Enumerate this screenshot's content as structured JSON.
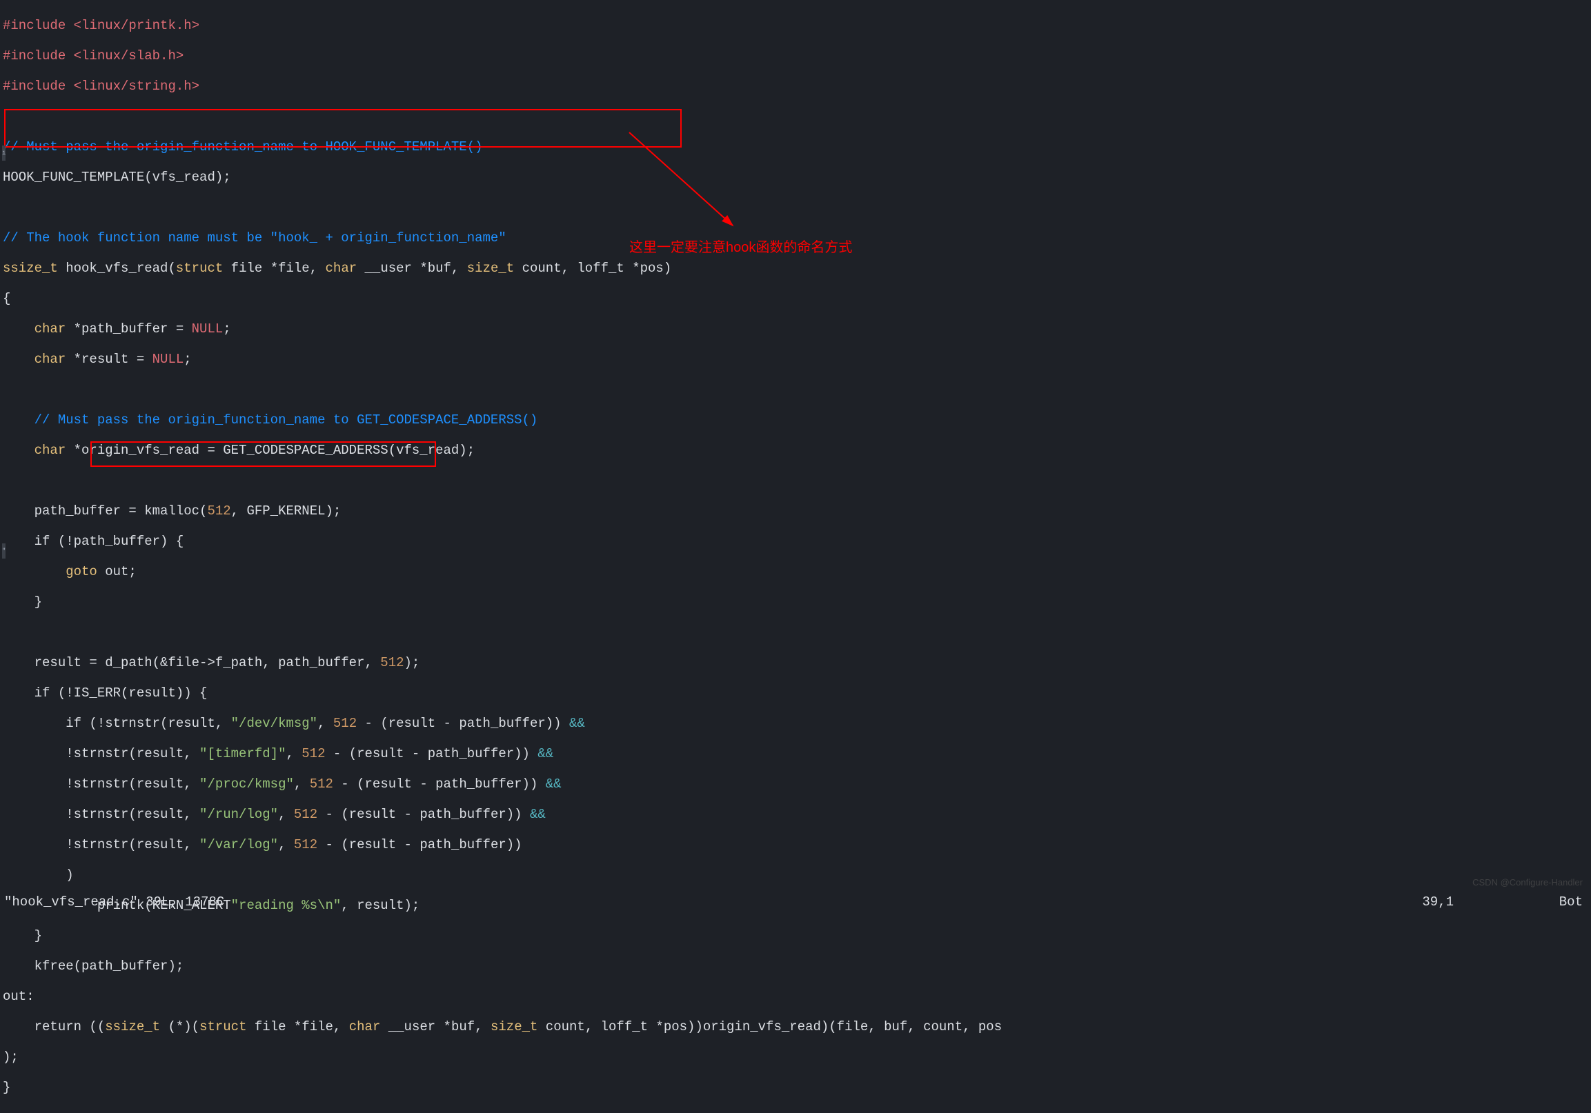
{
  "annotation_text": "这里一定要注意hook函数的命名方式",
  "code": {
    "inc1_kw": "#include",
    "inc1_path": " <linux/printk.h>",
    "inc2_kw": "#include",
    "inc2_path": " <linux/slab.h>",
    "inc3_kw": "#include",
    "inc3_path": " <linux/string.h>",
    "c1": "// Must pass the origin_function_name to HOOK_FUNC_TEMPLATE()",
    "l1": "HOOK_FUNC_TEMPLATE(vfs_read);",
    "c2": "// The hook function name must be \"hook_ + origin_function_name\"",
    "sig_ssize": "ssize_t",
    "sig_name": " hook_vfs_read(",
    "sig_struct": "struct",
    "sig_file_ptr": " file *file, ",
    "sig_char": "char",
    "sig_user_buf": " __user *buf, ",
    "sig_sizet": "size_t",
    "sig_count": " count, loff_t *pos)",
    "char_kw": "char",
    "pb_decl": " *path_buffer = ",
    "null_kw": "NULL",
    "semi": ";",
    "res_decl": " *result = ",
    "c3": "// Must pass the origin_function_name to GET_CODESPACE_ADDERSS()",
    "ovr": " *origin_vfs_read = GET_CODESPACE_ADDERSS(vfs_read);",
    "pb_km": "    path_buffer = kmalloc(",
    "n512": "512",
    "gfp": ", GFP_KERNEL);",
    "if_pb": "    if (!path_buffer) {",
    "goto_kw": "goto",
    "out_lbl": " out;",
    "brace_close": "    }",
    "res_dpath1": "    result = d_path(&file->f_path, path_buffer, ",
    "res_dpath2": ");",
    "if_iserr": "    if (!IS_ERR(result)) {",
    "if_strn1a": "        if (!strnstr(result, ",
    "s_devkmsg": "\"/dev/kmsg\"",
    "strn_mid": ", ",
    "strn_tail": " - (result - path_buffer)) ",
    "and": "&&",
    "bang_strn": "        !strnstr(result, ",
    "s_timerfd": "\"[timerfd]\"",
    "s_prockmsg": "\"/proc/kmsg\"",
    "s_runlog": "\"/run/log\"",
    "s_varlog": "\"/var/log\"",
    "strn_tail_noand": " - (result - path_buffer))",
    "paren_close": "        )",
    "printk_pre": "            printk(KERN_ALERT",
    "printk_str": "\"reading %s\\n\"",
    "printk_post": ", result);",
    "kfree": "    kfree(path_buffer);",
    "out_label": "out:",
    "ret_pre": "    return ((",
    "ret_ssize": "ssize_t",
    "ret_cast1": " (*)(",
    "ret_struct": "struct",
    "ret_file": " file *file, ",
    "ret_char": "char",
    "ret_user": " __user *buf, ",
    "ret_sizet": "size_t",
    "ret_rest": " count, loff_t *pos))origin_vfs_read)(file, buf, count, pos",
    "ret_end": ");"
  },
  "status": {
    "file_info": "\"hook_vfs_read.c\" 39L, 1378C",
    "pos": "39,1",
    "scroll": "Bot"
  },
  "watermark": "CSDN @Configure-Handler"
}
